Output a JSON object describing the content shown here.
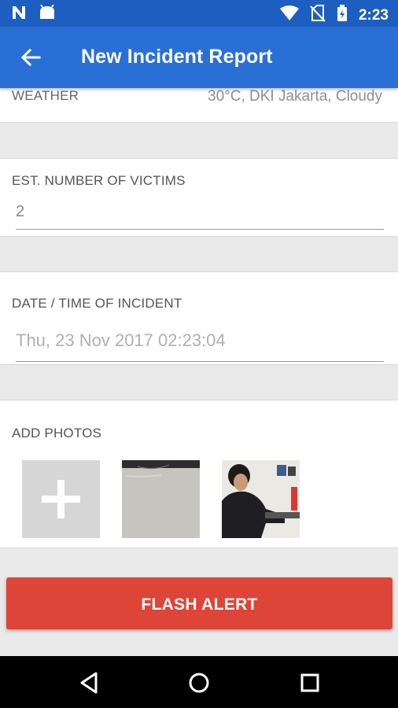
{
  "status_bar": {
    "time": "2:23",
    "left_icons": [
      "n-logo-icon",
      "android-icon"
    ],
    "right_icons": [
      "wifi-icon",
      "no-sim-icon",
      "battery-icon"
    ]
  },
  "app_bar": {
    "title": "New Incident Report",
    "back_icon": "arrow-left-icon",
    "color": "#2a6fd6"
  },
  "weather": {
    "label": "WEATHER",
    "value": "30°C,  DKI Jakarta, Cloudy"
  },
  "victims": {
    "label": "EST. NUMBER OF VICTIMS",
    "value": "2"
  },
  "date_time": {
    "label": "DATE / TIME OF INCIDENT",
    "placeholder": "Thu, 23 Nov 2017 02:23:04"
  },
  "photos": {
    "label": "ADD PHOTOS",
    "add_icon": "plus-icon",
    "thumbnails": [
      "photo-floor",
      "photo-person"
    ]
  },
  "flash_alert": {
    "label": "FLASH ALERT",
    "color": "#dd4538"
  },
  "nav_bar": {
    "buttons": [
      "back-triangle-icon",
      "home-circle-icon",
      "recents-square-icon"
    ]
  }
}
